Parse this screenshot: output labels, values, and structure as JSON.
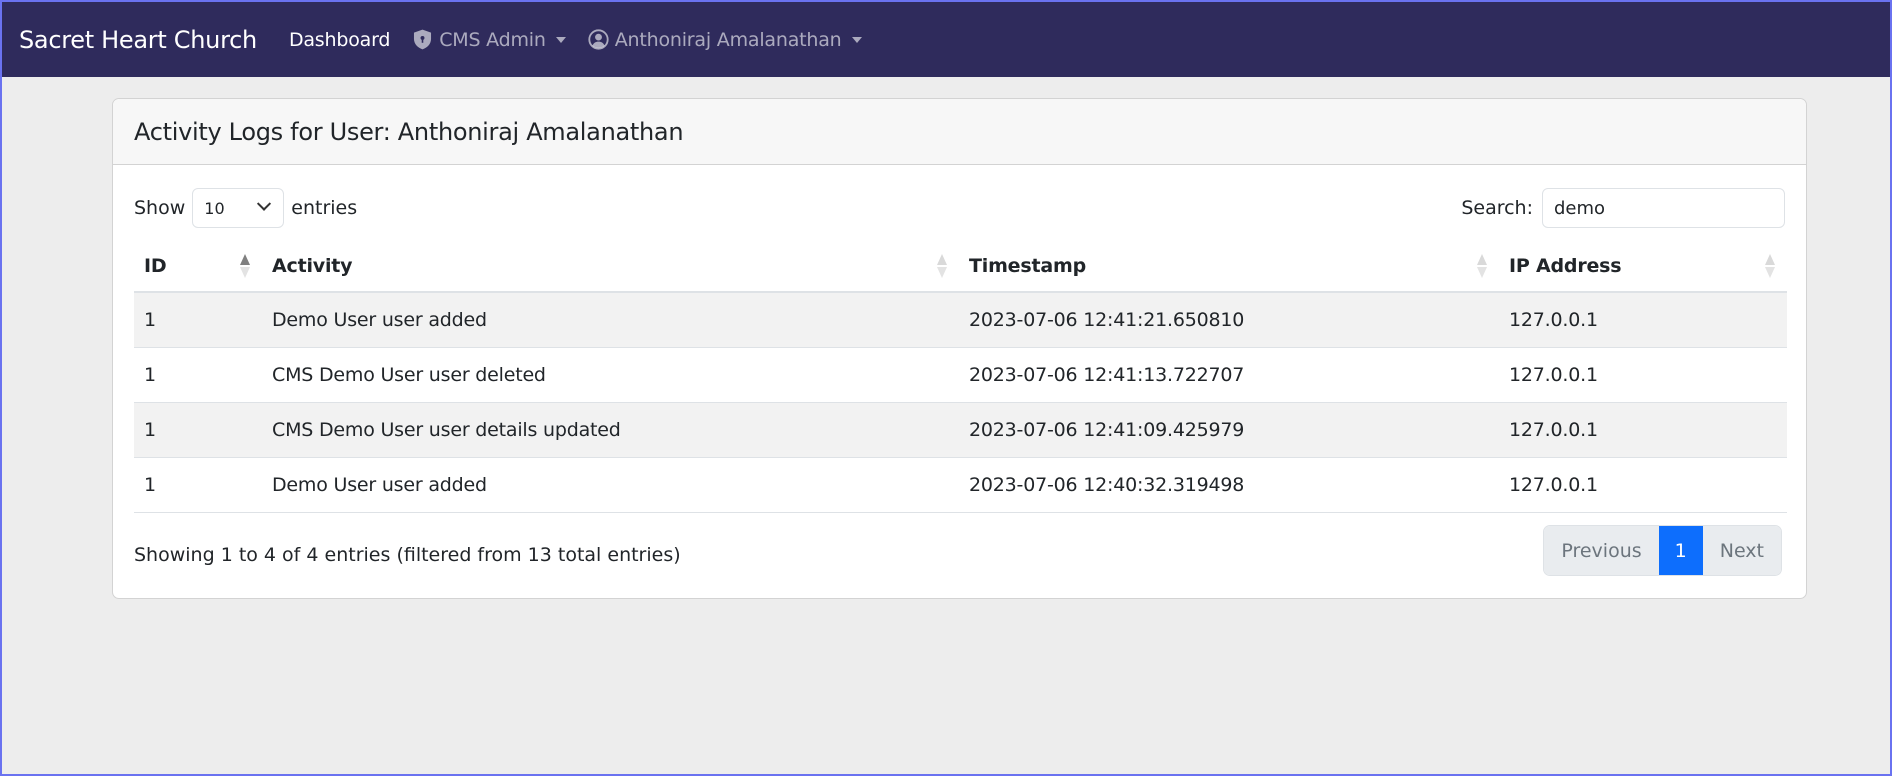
{
  "navbar": {
    "brand": "Sacret Heart Church",
    "links": [
      {
        "label": "Dashboard",
        "icon": null,
        "active": true,
        "dropdown": false
      },
      {
        "label": "CMS Admin",
        "icon": "shield-lock-icon",
        "active": false,
        "dropdown": true
      },
      {
        "label": "Anthoniraj Amalanathan",
        "icon": "user-circle-icon",
        "active": false,
        "dropdown": true
      }
    ]
  },
  "card": {
    "title": "Activity Logs for User: Anthoniraj Amalanathan"
  },
  "controls": {
    "show_label": "Show",
    "page_length": "10",
    "entries_label": "entries",
    "search_label": "Search:",
    "search_value": "demo"
  },
  "table": {
    "columns": [
      {
        "label": "ID",
        "sort": "asc"
      },
      {
        "label": "Activity",
        "sort": "none"
      },
      {
        "label": "Timestamp",
        "sort": "none"
      },
      {
        "label": "IP Address",
        "sort": "none"
      }
    ],
    "rows": [
      {
        "id": "1",
        "activity": "Demo User user added",
        "timestamp": "2023-07-06 12:41:21.650810",
        "ip": "127.0.0.1"
      },
      {
        "id": "1",
        "activity": "CMS Demo User user deleted",
        "timestamp": "2023-07-06 12:41:13.722707",
        "ip": "127.0.0.1"
      },
      {
        "id": "1",
        "activity": "CMS Demo User user details updated",
        "timestamp": "2023-07-06 12:41:09.425979",
        "ip": "127.0.0.1"
      },
      {
        "id": "1",
        "activity": "Demo User user added",
        "timestamp": "2023-07-06 12:40:32.319498",
        "ip": "127.0.0.1"
      }
    ]
  },
  "footer": {
    "info": "Showing 1 to 4 of 4 entries (filtered from 13 total entries)",
    "pagination": {
      "previous": "Previous",
      "pages": [
        "1"
      ],
      "current": "1",
      "next": "Next"
    }
  },
  "colors": {
    "navbar_bg": "#2f2b5c",
    "page_bg": "#ededed",
    "accent": "#0d6efd",
    "window_border": "#6a72f0"
  }
}
